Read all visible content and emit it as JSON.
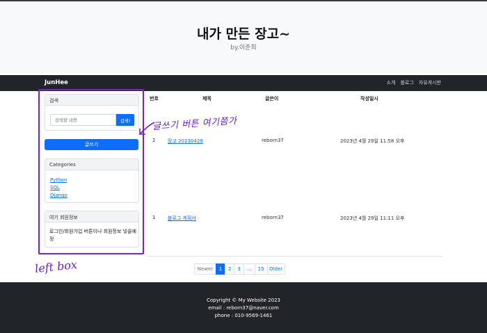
{
  "hero": {
    "title": "내가 만든 장고~",
    "subtitle": "by.이준희"
  },
  "navbar": {
    "brand": "JunHee",
    "links": [
      "소개",
      "블로그",
      "자유게시판"
    ]
  },
  "sidebar": {
    "search": {
      "header": "검색",
      "placeholder": "검색할 내용",
      "button": "검색!"
    },
    "write_button": "글쓰기",
    "categories": {
      "header": "Categories",
      "items": [
        "Python",
        "SQL",
        "Django"
      ]
    },
    "member": {
      "header": "여기 회원정보",
      "body": "로그인/회원가입 버튼이나 회원정보 넣을예정"
    }
  },
  "table": {
    "headers": [
      "번호",
      "제목",
      "글쓴이",
      "작성일시"
    ],
    "rows": [
      {
        "no": "2",
        "title": "장고 20230429",
        "author": "reborn37",
        "date": "2023년 4월 29일 11:58 오후"
      },
      {
        "no": "1",
        "title": "블로그 계획서",
        "author": "reborn37",
        "date": "2023년 4월 29일 11:11 오후"
      }
    ]
  },
  "pagination": {
    "newer": "Newer",
    "pages": [
      "1",
      "2",
      "3",
      "...",
      "15"
    ],
    "older": "Older",
    "active": "1"
  },
  "annotations": {
    "note": "글쓰기 버튼 여기쯤가",
    "left_label": "left box"
  },
  "footer": {
    "copyright": "Copyright © My Website 2023",
    "email": "email : reborn37@naver.com",
    "phone": "phone : 010-9569-1461"
  },
  "colors": {
    "primary": "#0d6efd",
    "dark": "#212529",
    "annotation": "#7a1fd1"
  }
}
